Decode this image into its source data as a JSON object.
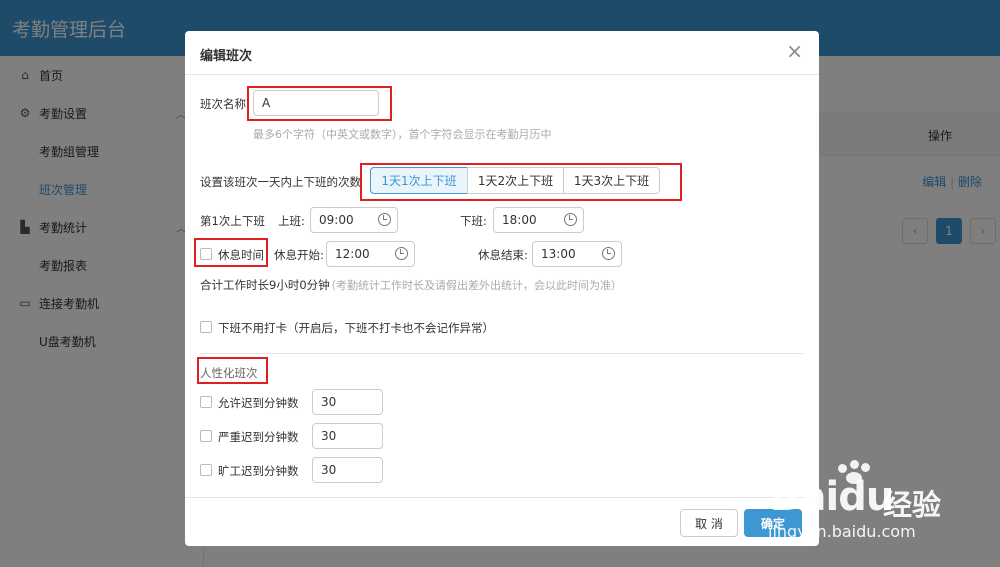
{
  "app": {
    "title": "考勤管理后台"
  },
  "sidebar": {
    "items": [
      {
        "label": "首页",
        "icon": "home-icon"
      },
      {
        "label": "考勤设置",
        "icon": "settings-icon"
      },
      {
        "label": "考勤组管理"
      },
      {
        "label": "班次管理",
        "active": true
      },
      {
        "label": "考勤统计",
        "icon": "chart-icon"
      },
      {
        "label": "考勤报表"
      },
      {
        "label": "连接考勤机",
        "icon": "device-icon"
      },
      {
        "label": "U盘考勤机"
      }
    ]
  },
  "table": {
    "op_header": "操作",
    "row_actions": {
      "edit": "编辑",
      "sep": "|",
      "delete": "删除"
    }
  },
  "pagination": {
    "prev": "‹",
    "current": "1",
    "next": "›"
  },
  "dialog": {
    "title": "编辑班次",
    "close": "×",
    "name_label": "班次名称",
    "name_value": "A",
    "name_hint": "最多6个字符（中英文或数字），首个字符会显示在考勤月历中",
    "times_label": "设置该班次一天内上下班的次数",
    "times_options": [
      "1天1次上下班",
      "1天2次上下班",
      "1天3次上下班"
    ],
    "times_selected": "1天1次上下班",
    "shift1_label": "第1次上下班",
    "on_label": "上班:",
    "on_value": "09:00",
    "off_label": "下班:",
    "off_value": "18:00",
    "rest_label": "休息时间",
    "rest_start_label": "休息开始:",
    "rest_start_value": "12:00",
    "rest_end_label": "休息结束:",
    "rest_end_value": "13:00",
    "total_label": "合计工作时长9小时0分钟",
    "total_hint": "（考勤统计工作时长及请假出差外出统计，会以此时间为准）",
    "no_punch_label": "下班不用打卡（开启后，下班不打卡也不会记作异常）",
    "humanize_title": "人性化班次",
    "late_label": "允许迟到分钟数",
    "late_value": "30",
    "serious_label": "严重迟到分钟数",
    "serious_value": "30",
    "absent_label": "旷工迟到分钟数",
    "absent_value": "30",
    "cancel": "取 消",
    "ok": "确定"
  },
  "watermark": {
    "brand": "Bai",
    "brand2": "du",
    "cn": "经验",
    "url": "jingyan.baidu.com"
  }
}
